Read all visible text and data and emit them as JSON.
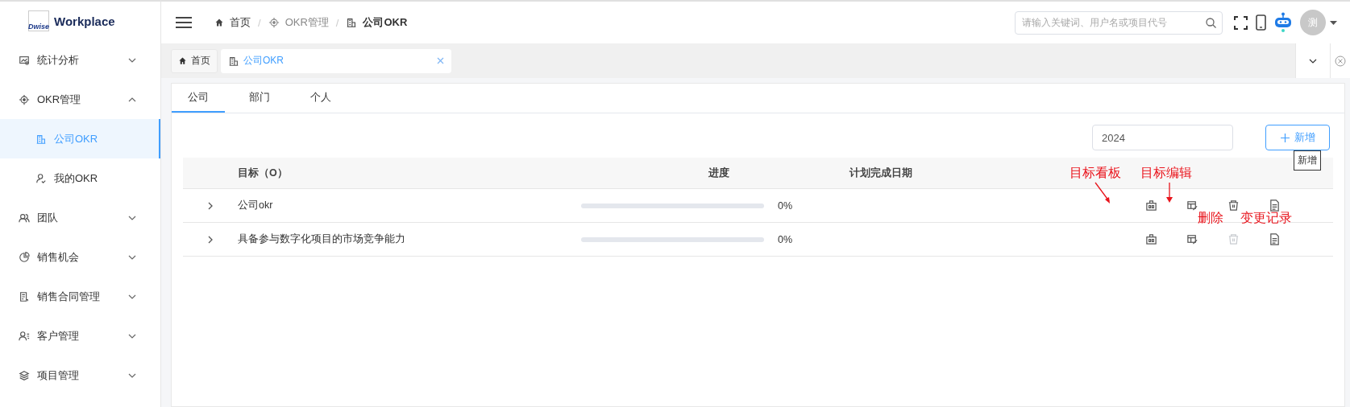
{
  "logo": {
    "badge": "Dwise",
    "title": "Workplace"
  },
  "sidebar": {
    "items": [
      {
        "label": "统计分析",
        "kind": "chart",
        "expanded": false
      },
      {
        "label": "OKR管理",
        "kind": "target",
        "expanded": true,
        "children": [
          {
            "label": "公司OKR",
            "kind": "building",
            "selected": true
          },
          {
            "label": "我的OKR",
            "kind": "user",
            "selected": false
          }
        ]
      },
      {
        "label": "团队",
        "kind": "team",
        "expanded": false
      },
      {
        "label": "销售机会",
        "kind": "pie",
        "expanded": false
      },
      {
        "label": "销售合同管理",
        "kind": "doc",
        "expanded": false
      },
      {
        "label": "客户管理",
        "kind": "userlist",
        "expanded": false
      },
      {
        "label": "项目管理",
        "kind": "layers",
        "expanded": false
      }
    ]
  },
  "breadcrumb": [
    {
      "label": "首页",
      "kind": "home"
    },
    {
      "label": "OKR管理",
      "kind": "target",
      "separator": "/"
    },
    {
      "label": "公司OKR",
      "kind": "building",
      "separator": "/"
    }
  ],
  "search": {
    "placeholder": "请输入关键词、用户名或项目代号"
  },
  "avatar": {
    "initial": "测"
  },
  "page_tabs": [
    {
      "label": "首页",
      "kind": "home",
      "selected": false,
      "closable": false
    },
    {
      "label": "公司OKR",
      "kind": "building",
      "selected": true,
      "closable": true
    }
  ],
  "content_tabs": [
    {
      "label": "公司",
      "selected": true
    },
    {
      "label": "部门",
      "selected": false
    },
    {
      "label": "个人",
      "selected": false
    }
  ],
  "year": {
    "value": "2024"
  },
  "add_button": {
    "label": "新增",
    "tooltip": "新增"
  },
  "table": {
    "columns": [
      "目标（O）",
      "进度",
      "计划完成日期"
    ],
    "rows": [
      {
        "goal": "公司okr",
        "level": 0,
        "percent": "0%",
        "delete_disabled": false
      },
      {
        "goal": "具备参与数字化项目的市场竞争能力",
        "level": 0,
        "percent": "0%",
        "delete_disabled": true
      }
    ]
  },
  "annotations": [
    {
      "text": "目标看板",
      "kind": "arrow"
    },
    {
      "text": "目标编辑",
      "kind": "arrow"
    },
    {
      "text": "删除",
      "kind": "label"
    },
    {
      "text": "变更记录",
      "kind": "label"
    }
  ]
}
